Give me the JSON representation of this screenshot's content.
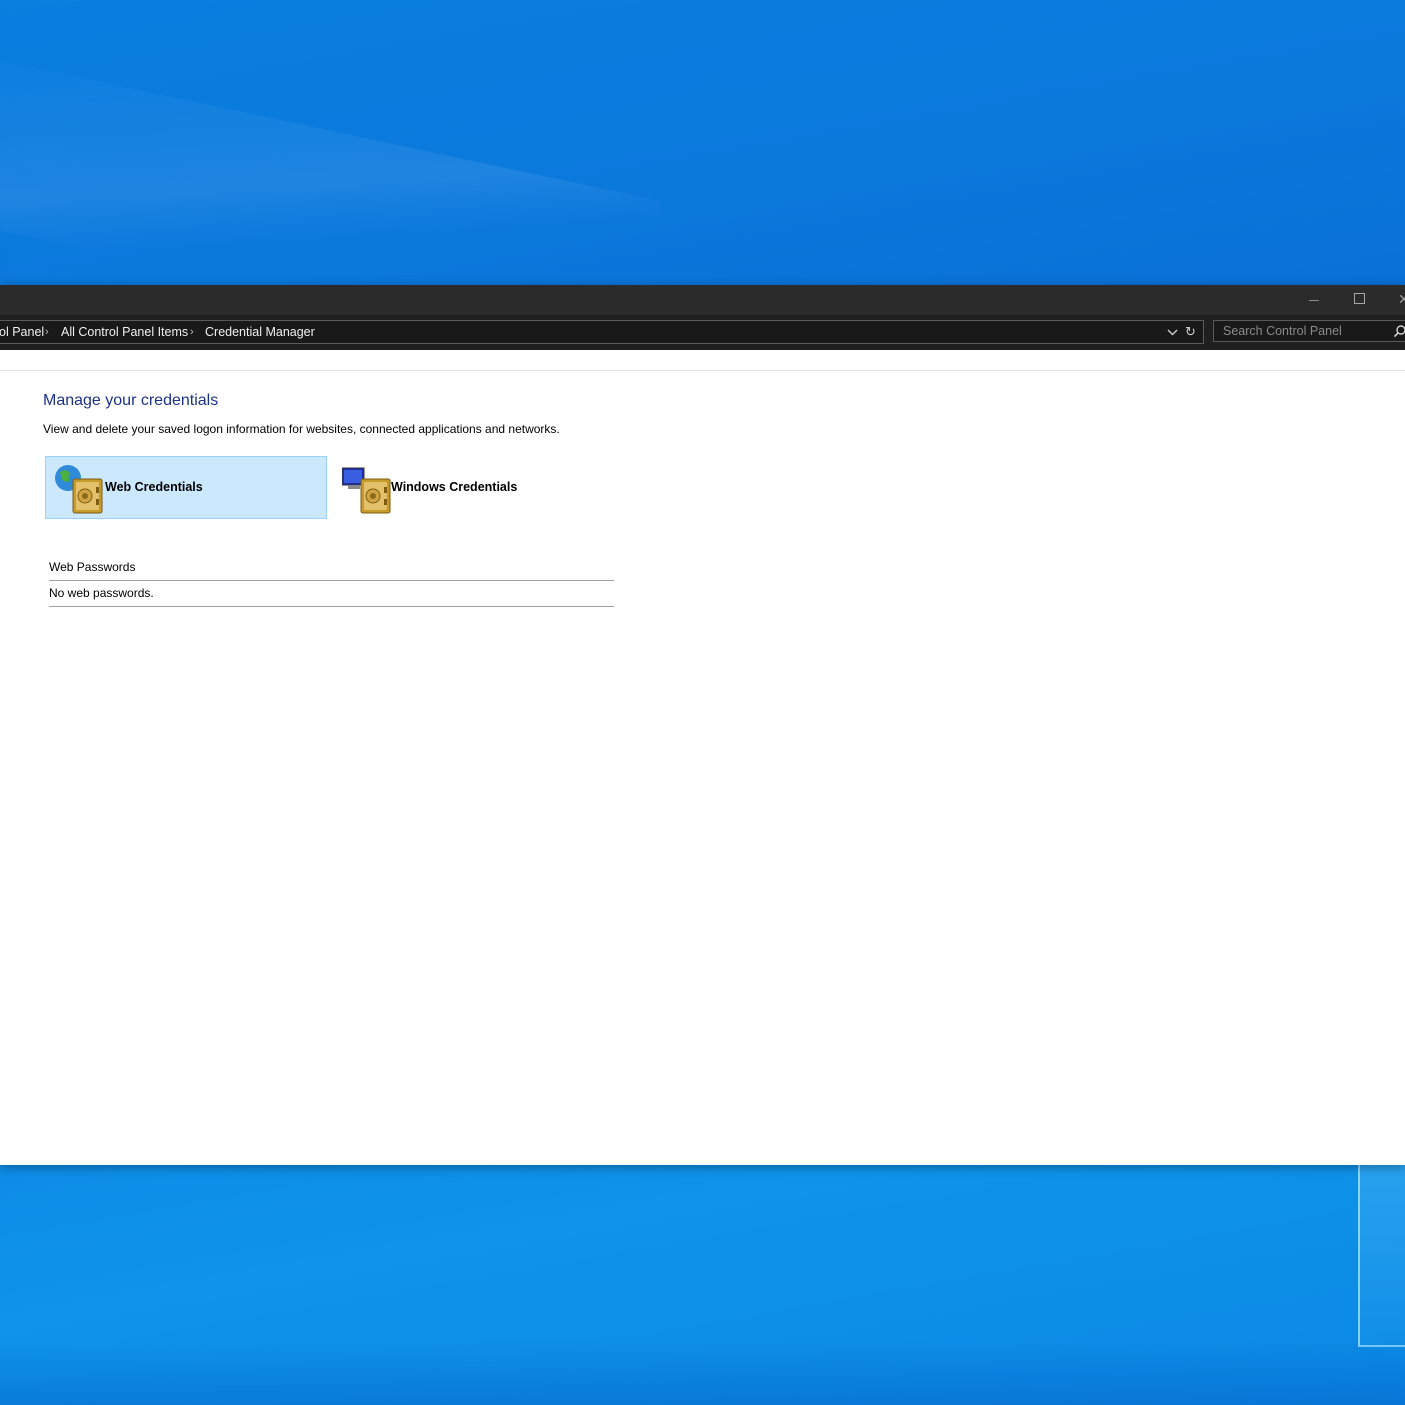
{
  "window": {
    "caption": {
      "minimize_glyph": "—",
      "close_glyph": "✕"
    }
  },
  "address_bar": {
    "crumbs": [
      "ol Panel",
      "All Control Panel Items",
      "Credential Manager"
    ],
    "separator": "›",
    "dropdown_glyph": "⌄",
    "refresh_glyph": "↻"
  },
  "search": {
    "placeholder": "Search Control Panel"
  },
  "main": {
    "heading": "Manage your credentials",
    "description": "View and delete your saved logon information for websites, connected applications and networks.",
    "tiles": [
      {
        "label": "Web Credentials",
        "icon": "web-credentials-vault-icon",
        "selected": true
      },
      {
        "label": "Windows Credentials",
        "icon": "windows-credentials-vault-icon",
        "selected": false
      }
    ],
    "section": {
      "title": "Web Passwords",
      "empty_message": "No web passwords."
    }
  },
  "colors": {
    "heading": "#1e3287",
    "tile_selected_bg": "#cce8ff",
    "tile_selected_border": "#99d1ff",
    "titlebar": "#2b2b2b"
  }
}
